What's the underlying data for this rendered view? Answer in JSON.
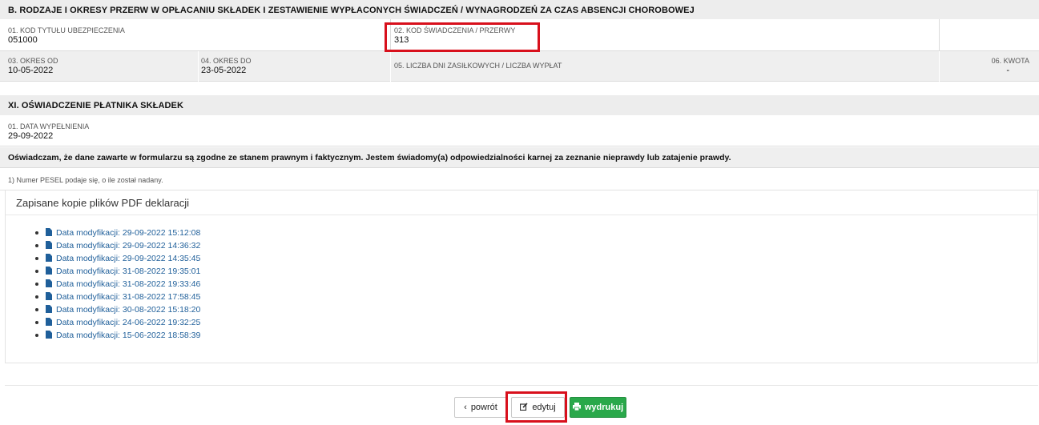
{
  "section_b": {
    "title": "B. RODZAJE I OKRESY PRZERW W OPŁACANIU SKŁADEK I ZESTAWIENIE WYPŁACONYCH ŚWIADCZEŃ / WYNAGRODZEŃ ZA CZAS ABSENCJI CHOROBOWEJ",
    "f01_label": "01. KOD TYTUŁU UBEZPIECZENIA",
    "f01_value": "051000",
    "f02_label": "02. KOD ŚWIADCZENIA / PRZERWY",
    "f02_value": "313",
    "f03_label": "03. OKRES OD",
    "f03_value": "10-05-2022",
    "f04_label": "04. OKRES DO",
    "f04_value": "23-05-2022",
    "f05_label": "05. LICZBA DNI ZASIŁKOWYCH / LICZBA WYPŁAT",
    "f05_value": "",
    "f06_label": "06. KWOTA",
    "f06_value": "-"
  },
  "section_xi": {
    "title": "XI. OŚWIADCZENIE PŁATNIKA SKŁADEK",
    "f01_label": "01. DATA WYPEŁNIENIA",
    "f01_value": "29-09-2022",
    "statement": "Oświadczam, że dane zawarte w formularzu są zgodne ze stanem prawnym i faktycznym. Jestem świadomy(a) odpowiedzialności karnej za zeznanie nieprawdy lub zatajenie prawdy.",
    "footnote": "1) Numer PESEL podaje się, o ile został nadany."
  },
  "pdf_panel": {
    "title": "Zapisane kopie plików PDF deklaracji",
    "icon": "file-icon",
    "items": [
      "Data modyfikacji: 29-09-2022 15:12:08",
      "Data modyfikacji: 29-09-2022 14:36:32",
      "Data modyfikacji: 29-09-2022 14:35:45",
      "Data modyfikacji: 31-08-2022 19:35:01",
      "Data modyfikacji: 31-08-2022 19:33:46",
      "Data modyfikacji: 31-08-2022 17:58:45",
      "Data modyfikacji: 30-08-2022 15:18:20",
      "Data modyfikacji: 24-06-2022 19:32:25",
      "Data modyfikacji: 15-06-2022 18:58:39"
    ]
  },
  "buttons": {
    "back_label": "powrót",
    "edit_label": "edytuj",
    "print_label": "wydrukuj",
    "back_icon": "chevron-left-icon",
    "edit_icon": "edit-icon",
    "print_icon": "print-icon"
  },
  "colors": {
    "highlight": "#d8101c",
    "link": "#1f5f9a",
    "success": "#2aa84a"
  }
}
